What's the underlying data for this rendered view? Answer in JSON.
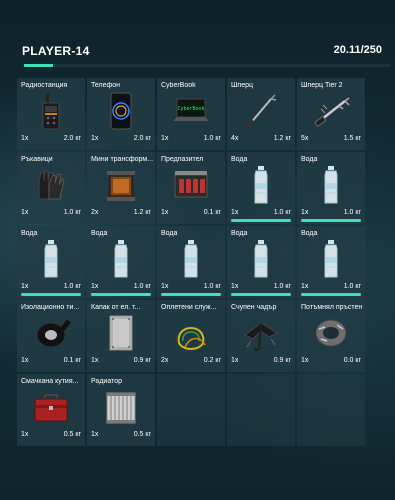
{
  "header": {
    "player": "PLAYER-14",
    "capacity": "20.11/250"
  },
  "colors": {
    "accent": "#3ee0b4",
    "slot": "#223c46",
    "background": "#10252e"
  },
  "capacity_fraction": 0.08,
  "items": [
    {
      "name": "Радиостанция",
      "qty": "1x",
      "weight": "2.0 кг",
      "icon": "radio-icon"
    },
    {
      "name": "Телефон",
      "qty": "1x",
      "weight": "2.0 кг",
      "icon": "phone-icon"
    },
    {
      "name": "CyberBook",
      "qty": "1x",
      "weight": "1.0 кг",
      "icon": "laptop-icon"
    },
    {
      "name": "Шперц",
      "qty": "4x",
      "weight": "1.2 кг",
      "icon": "lockpick-icon"
    },
    {
      "name": "Шперц Tier 2",
      "qty": "5x",
      "weight": "1.5 кг",
      "icon": "lockpick-tier2-icon"
    },
    {
      "name": "Ръкавици",
      "qty": "1x",
      "weight": "1.0 кг",
      "icon": "gloves-icon"
    },
    {
      "name": "Мини трансформ...",
      "qty": "2x",
      "weight": "1.2 кг",
      "icon": "transformer-icon"
    },
    {
      "name": "Предпазител",
      "qty": "1x",
      "weight": "0.1 кг",
      "icon": "fuse-icon"
    },
    {
      "name": "Вода",
      "qty": "1x",
      "weight": "1.0 кг",
      "icon": "water-bottle-icon",
      "durability": 1.0
    },
    {
      "name": "Вода",
      "qty": "1x",
      "weight": "1.0 кг",
      "icon": "water-bottle-icon",
      "durability": 1.0
    },
    {
      "name": "Вода",
      "qty": "1x",
      "weight": "1.0 кг",
      "icon": "water-bottle-icon",
      "durability": 1.0
    },
    {
      "name": "Вода",
      "qty": "1x",
      "weight": "1.0 кг",
      "icon": "water-bottle-icon",
      "durability": 1.0
    },
    {
      "name": "Вода",
      "qty": "1x",
      "weight": "1.0 кг",
      "icon": "water-bottle-icon",
      "durability": 1.0
    },
    {
      "name": "Вода",
      "qty": "1x",
      "weight": "1.0 кг",
      "icon": "water-bottle-icon",
      "durability": 1.0
    },
    {
      "name": "Вода",
      "qty": "1x",
      "weight": "1.0 кг",
      "icon": "water-bottle-icon",
      "durability": 1.0
    },
    {
      "name": "Изолационно ти...",
      "qty": "1x",
      "weight": "0.1 кг",
      "icon": "tape-icon"
    },
    {
      "name": "Капак от ел. т...",
      "qty": "1x",
      "weight": "0.9 кг",
      "icon": "panel-cover-icon"
    },
    {
      "name": "Оплетени служ...",
      "qty": "2x",
      "weight": "0.2 кг",
      "icon": "wires-icon"
    },
    {
      "name": "Счупен чадър",
      "qty": "1x",
      "weight": "0.9 кг",
      "icon": "broken-umbrella-icon"
    },
    {
      "name": "Потъмнял пръстен",
      "qty": "1x",
      "weight": "0.0 кг",
      "icon": "ring-icon"
    },
    {
      "name": "Смачкана кутия...",
      "qty": "1x",
      "weight": "0.5 кг",
      "icon": "toolbox-icon"
    },
    {
      "name": "Радиатор",
      "qty": "1x",
      "weight": "0.5 кг",
      "icon": "radiator-icon"
    },
    null,
    null,
    null
  ]
}
